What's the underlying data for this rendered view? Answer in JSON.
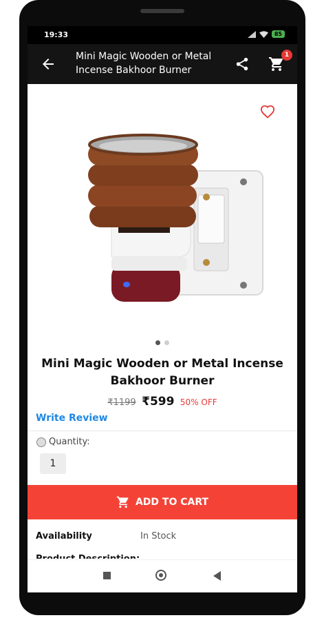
{
  "status": {
    "time": "19:33",
    "battery": "85"
  },
  "appbar": {
    "title": "Mini Magic Wooden or Metal Incense Bakhoor Burner",
    "cart_count": "1"
  },
  "product": {
    "name": "Mini Magic Wooden or Metal Incense Bakhoor Burner",
    "mrp": "₹1199",
    "price": "₹599",
    "discount": "50% OFF",
    "image_count": 2,
    "active_image": 1
  },
  "review": {
    "label": "Write Review"
  },
  "quantity": {
    "label": "Quantity:",
    "value": "1"
  },
  "cart": {
    "label": "ADD TO CART"
  },
  "details": {
    "availability_label": "Availability",
    "availability_value": "In Stock",
    "description_label": "Product Description:"
  },
  "colors": {
    "accent": "#f44336",
    "link": "#1e88e5",
    "appbar": "#141414"
  },
  "icons": [
    "back-arrow-icon",
    "share-icon",
    "cart-icon",
    "heart-icon",
    "cart-button-icon",
    "nav-recents-icon",
    "nav-home-icon",
    "nav-back-icon"
  ]
}
